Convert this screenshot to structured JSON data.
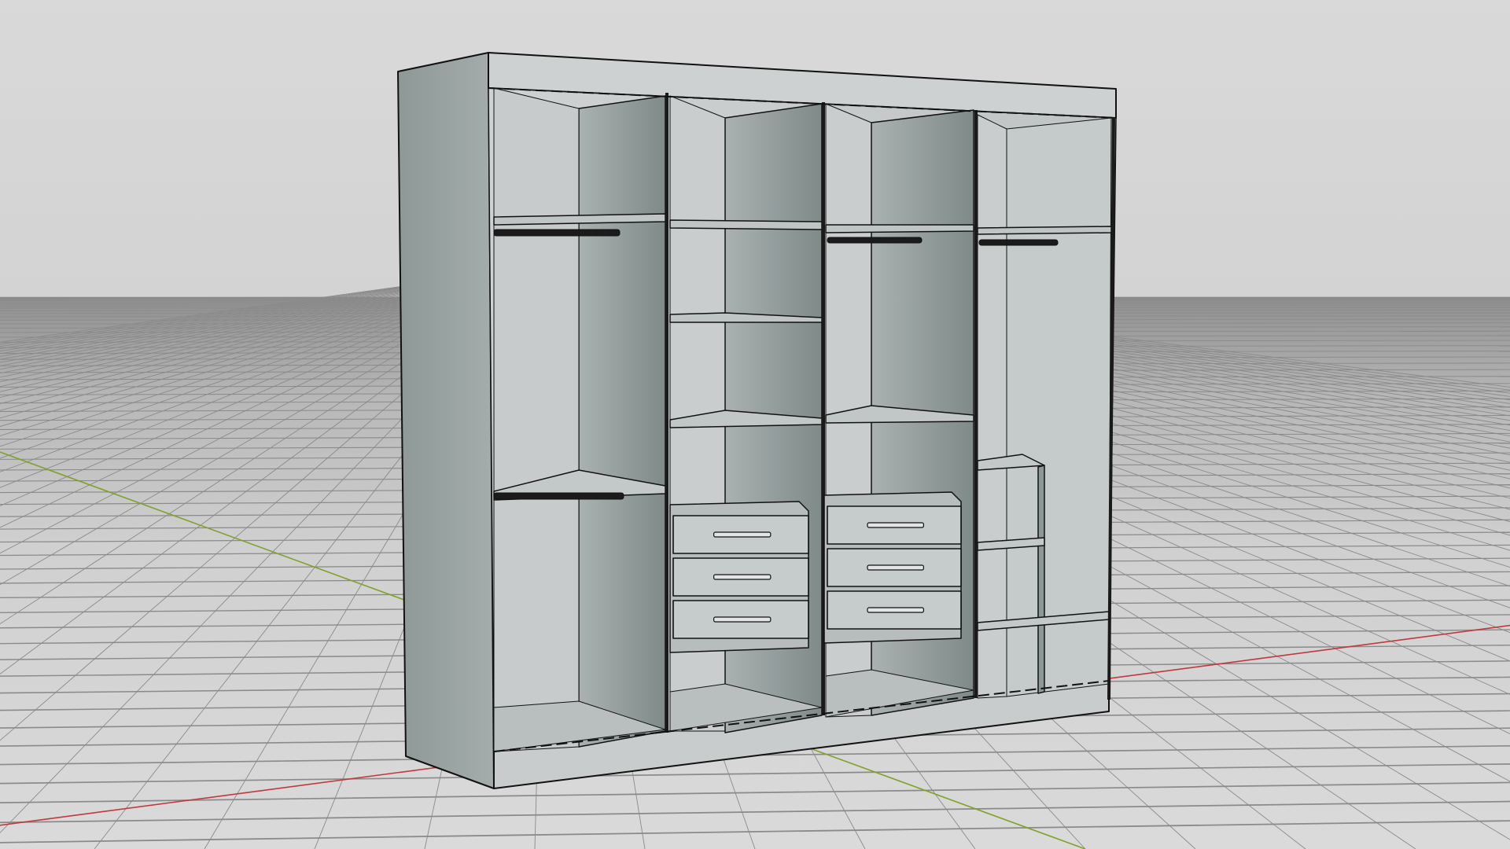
{
  "viewport": {
    "view": "perspective",
    "shading": "shaded-with-edges",
    "colors": {
      "background": "#d6d6d6",
      "grid_line": "#8a8a8a",
      "x_axis": "#c0393b",
      "y_axis": "#7fa12a",
      "cabinet_face": "#cfd3d3",
      "cabinet_side": "#9aa3a2",
      "cabinet_interior": "#a7aeae",
      "edge": "#111111"
    }
  },
  "model": {
    "object": "wardrobe",
    "columns": [
      {
        "id": "col-1",
        "shelves": 2,
        "hanging_rails": 2,
        "drawers": 0
      },
      {
        "id": "col-2",
        "shelves": 3,
        "hanging_rails": 0,
        "drawers": 3
      },
      {
        "id": "col-3",
        "shelves": 2,
        "hanging_rails": 1,
        "drawers": 3
      },
      {
        "id": "col-4",
        "shelves": 4,
        "hanging_rails": 1,
        "drawers": 0
      }
    ]
  }
}
